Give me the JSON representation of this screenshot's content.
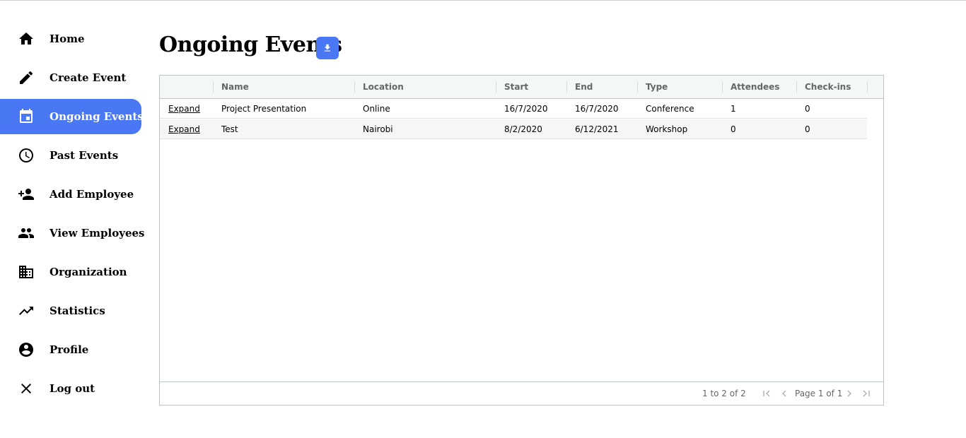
{
  "sidebar": {
    "items": [
      {
        "label": "Home",
        "icon": "home-icon"
      },
      {
        "label": "Create Event",
        "icon": "pencil-icon"
      },
      {
        "label": "Ongoing Events",
        "icon": "calendar-icon",
        "active": true
      },
      {
        "label": "Past Events",
        "icon": "clock-icon"
      },
      {
        "label": "Add Employee",
        "icon": "person-add-icon"
      },
      {
        "label": "View Employees",
        "icon": "people-icon"
      },
      {
        "label": "Organization",
        "icon": "building-icon"
      },
      {
        "label": "Statistics",
        "icon": "trending-up-icon"
      },
      {
        "label": "Profile",
        "icon": "account-circle-icon"
      },
      {
        "label": "Log out",
        "icon": "close-icon"
      }
    ]
  },
  "main": {
    "title": "Ongoing Events",
    "download_icon": "download-icon"
  },
  "grid": {
    "columns": [
      "",
      "Name",
      "Location",
      "Start",
      "End",
      "Type",
      "Attendees",
      "Check-ins"
    ],
    "rows": [
      {
        "action": "Expand",
        "name": "Project Presentation",
        "location": "Online",
        "start": "16/7/2020",
        "end": "16/7/2020",
        "type": "Conference",
        "attendees": "1",
        "checkins": "0"
      },
      {
        "action": "Expand",
        "name": "Test",
        "location": "Nairobi",
        "start": "8/2/2020",
        "end": "6/12/2021",
        "type": "Workshop",
        "attendees": "0",
        "checkins": "0"
      }
    ],
    "footer": {
      "summary": "1 to 2 of 2",
      "page_desc": "Page 1 of 1"
    }
  },
  "colors": {
    "accent": "#4a78f5",
    "header_bg": "#f5f7f7",
    "border": "#bdc3c7"
  }
}
